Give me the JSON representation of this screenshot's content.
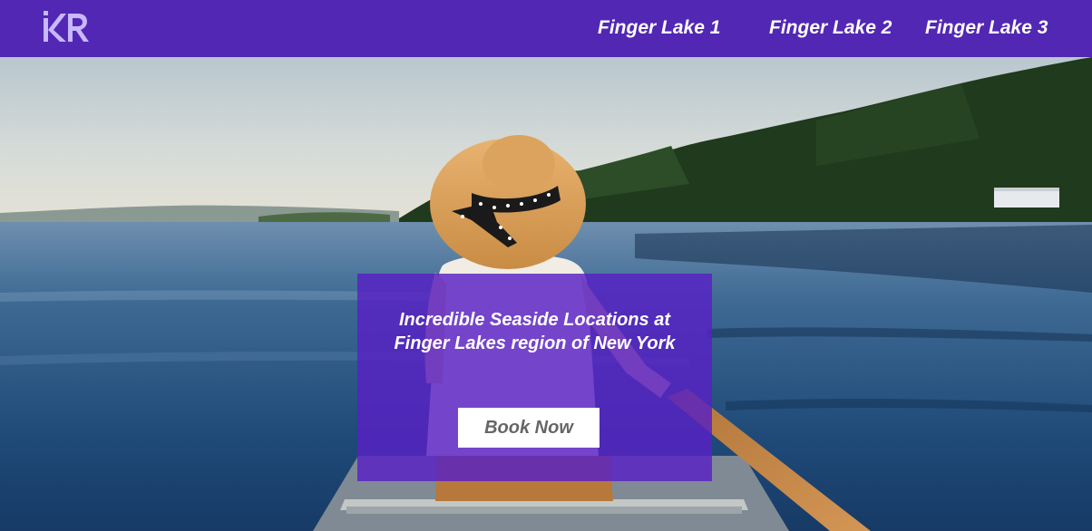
{
  "header": {
    "logo_text": "KR",
    "nav": [
      {
        "label": "Finger Lake 1"
      },
      {
        "label": "Finger Lake 2"
      },
      {
        "label": "Finger Lake 3"
      }
    ]
  },
  "hero": {
    "heading_line1": "Incredible Seaside Locations at",
    "heading_line2": "Finger Lakes region of New York",
    "cta_label": "Book Now",
    "image": "woman-in-sun-hat-canoeing-on-lake"
  },
  "colors": {
    "brand": "#5227b3",
    "overlay": "#5820c4",
    "button_text": "#666666"
  }
}
